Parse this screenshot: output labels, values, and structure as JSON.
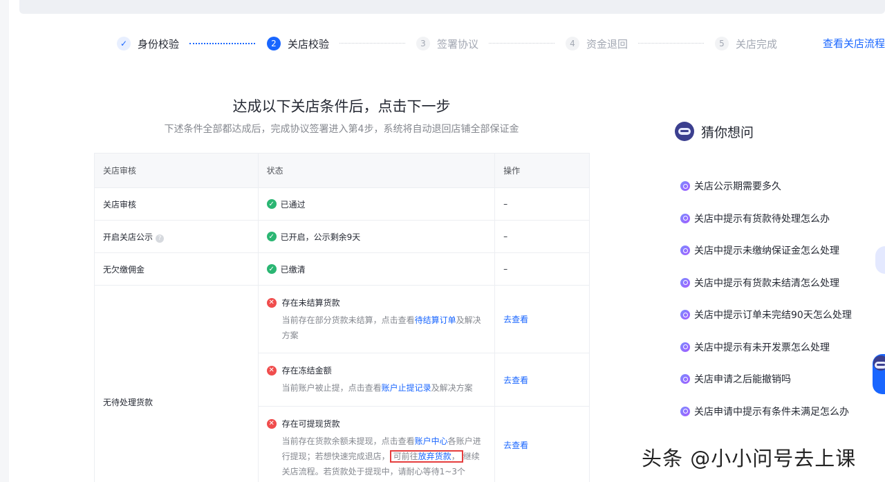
{
  "steps": [
    {
      "num": "✓",
      "label": "身份校验"
    },
    {
      "num": "2",
      "label": "关店校验"
    },
    {
      "num": "3",
      "label": "签署协议"
    },
    {
      "num": "4",
      "label": "资金退回"
    },
    {
      "num": "5",
      "label": "关店完成"
    }
  ],
  "flow_link": "查看关店流程",
  "title": "达成以下关店条件后，点击下一步",
  "subtitle": "下述条件全部都达成后，完成协议签署进入第4步，系统将自动退回店铺全部保证金",
  "table": {
    "headers": [
      "关店审核",
      "状态",
      "操作"
    ],
    "rows": [
      {
        "name": "关店审核",
        "status": "已通过",
        "op": "–"
      },
      {
        "name": "开启关店公示",
        "status": "已开启，公示剩余9天",
        "op": "–"
      },
      {
        "name": "无欠缴佣金",
        "status": "已缴清",
        "op": "–"
      }
    ],
    "pending": {
      "name": "无待处理货款",
      "items": [
        {
          "title": "存在未结算货款",
          "desc_a": "当前存在部分货款未结算，点击查看",
          "link": "待结算订单",
          "desc_b": "及解决方案",
          "op": "去查看"
        },
        {
          "title": "存在冻结金额",
          "desc_a": "当前账户被止提，点击查看",
          "link": "账户止提记录",
          "desc_b": "及解决方案",
          "op": "去查看"
        },
        {
          "title": "存在可提现货款",
          "desc_a": "当前存在货款余额未提现，点击查看",
          "link": "账户中心",
          "desc_b": "各账户进行提现；若想快速完成退店，",
          "boxed_a": "可前往",
          "boxed_link": "放弃货款",
          "boxed_b": "，",
          "desc_c": "继续关店流程。若货款处于提现中，请耐心等待1~3个",
          "op": "去查看"
        }
      ]
    }
  },
  "guess": {
    "title": "猜你想问",
    "items": [
      "关店公示期需要多久",
      "关店中提示有货款待处理怎么办",
      "关店中提示未缴纳保证金怎么处理",
      "关店中提示有货款未结清怎么处理",
      "关店中提示订单未完结90天怎么处理",
      "关店中提示有未开发票怎么处理",
      "关店申请之后能撤销吗",
      "关店申请中提示有条件未满足怎么办"
    ]
  },
  "watermark": "头条 @小小问号去上课"
}
